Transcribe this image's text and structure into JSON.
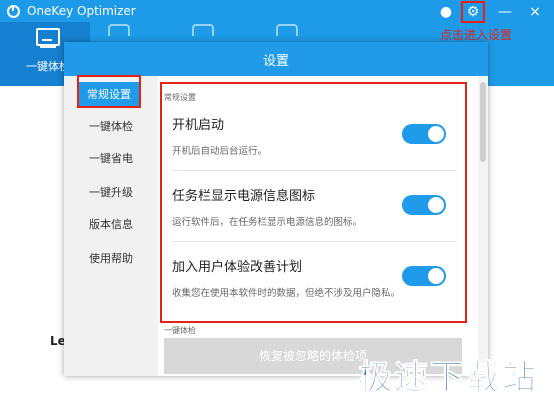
{
  "app": {
    "title": "OneKey Optimizer",
    "accent_color": "#1e9be8",
    "top_tab_label": "一键体检",
    "bg_left_text": "Le"
  },
  "window_controls": {
    "chat_icon": "chat-bubble-icon",
    "settings_icon": "gear-icon",
    "minimize": "—",
    "close": "×"
  },
  "annotation": {
    "text": "点击进入设置",
    "color": "#e2231a"
  },
  "dialog": {
    "title": "设置",
    "nav": [
      {
        "label": "常规设置",
        "active": true
      },
      {
        "label": "一键体检",
        "active": false
      },
      {
        "label": "一键省电",
        "active": false
      },
      {
        "label": "一键升级",
        "active": false
      },
      {
        "label": "版本信息",
        "active": false
      },
      {
        "label": "使用帮助",
        "active": false
      }
    ],
    "section_general": "常规设置",
    "settings": [
      {
        "title": "开机启动",
        "desc": "开机后自动后台运行。",
        "enabled": true
      },
      {
        "title": "任务栏显示电源信息图标",
        "desc": "运行软件后，在任务栏显示电源信息的图标。",
        "enabled": true
      },
      {
        "title": "加入用户体验改善计划",
        "desc": "收集您在使用本软件时的数据，但绝不涉及用户隐私。",
        "enabled": true
      }
    ],
    "section_checkup": "一键体检",
    "restore_button": "恢复被忽略的体检项"
  },
  "watermark": "极速下载站"
}
